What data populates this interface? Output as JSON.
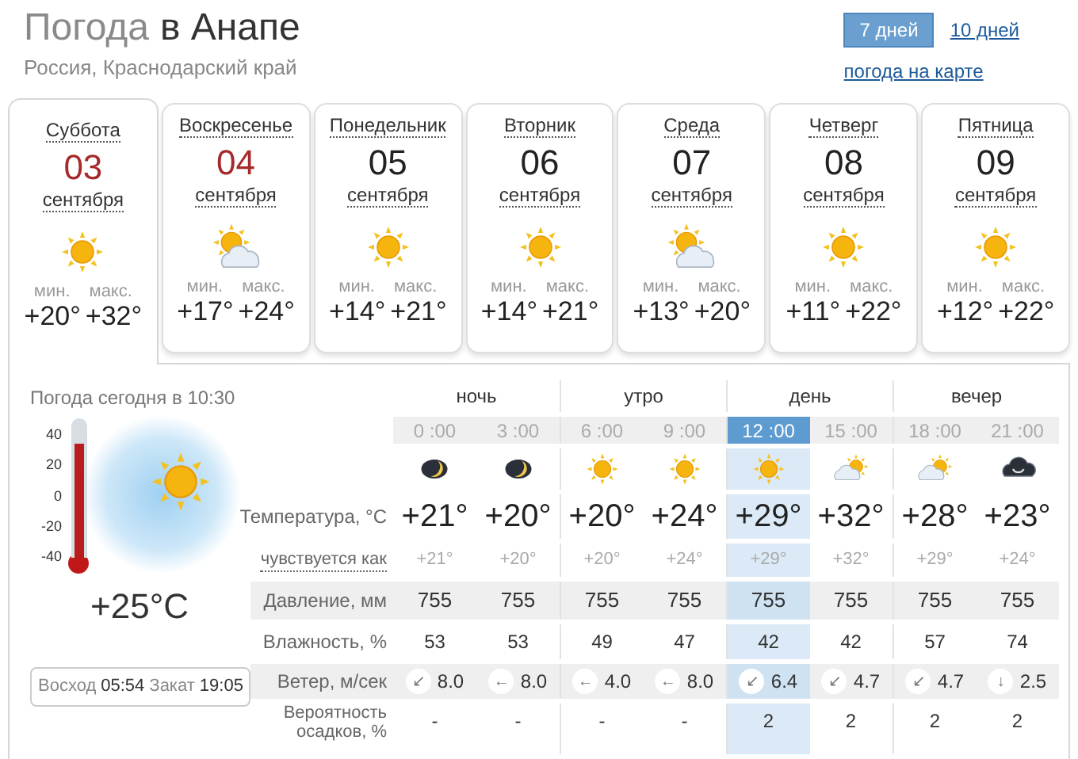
{
  "header": {
    "title_prefix": "Погода",
    "city": "в Анапе",
    "region": "Россия, Краснодарский край",
    "tabs": [
      {
        "label": "7 дней",
        "selected": true
      },
      {
        "label": "10 дней",
        "selected": false
      }
    ],
    "map_link": "погода на карте"
  },
  "days": [
    {
      "weekday": "Суббота",
      "date": "03",
      "month": "сентября",
      "kind": "sun",
      "weekend": true,
      "selected": true,
      "min_label": "мин.",
      "max_label": "макс.",
      "min": "+20°",
      "max": "+32°"
    },
    {
      "weekday": "Воскресенье",
      "date": "04",
      "month": "сентября",
      "kind": "partly_cloudy",
      "weekend": true,
      "selected": false,
      "min_label": "мин.",
      "max_label": "макс.",
      "min": "+17°",
      "max": "+24°"
    },
    {
      "weekday": "Понедельник",
      "date": "05",
      "month": "сентября",
      "kind": "sun",
      "weekend": false,
      "selected": false,
      "min_label": "мин.",
      "max_label": "макс.",
      "min": "+14°",
      "max": "+21°"
    },
    {
      "weekday": "Вторник",
      "date": "06",
      "month": "сентября",
      "kind": "sun",
      "weekend": false,
      "selected": false,
      "min_label": "мин.",
      "max_label": "макс.",
      "min": "+14°",
      "max": "+21°"
    },
    {
      "weekday": "Среда",
      "date": "07",
      "month": "сентября",
      "kind": "partly_cloudy",
      "weekend": false,
      "selected": false,
      "min_label": "мин.",
      "max_label": "макс.",
      "min": "+13°",
      "max": "+20°"
    },
    {
      "weekday": "Четверг",
      "date": "08",
      "month": "сентября",
      "kind": "sun",
      "weekend": false,
      "selected": false,
      "min_label": "мин.",
      "max_label": "макс.",
      "min": "+11°",
      "max": "+22°"
    },
    {
      "weekday": "Пятница",
      "date": "09",
      "month": "сентября",
      "kind": "sun",
      "weekend": false,
      "selected": false,
      "min_label": "мин.",
      "max_label": "макс.",
      "min": "+12°",
      "max": "+22°"
    }
  ],
  "current": {
    "caption": "Погода сегодня в 10:30",
    "scale": [
      "40",
      "20",
      "0",
      "-20",
      "-40"
    ],
    "level": 0.82,
    "temperature": "+25°C",
    "sunrise_label": "Восход",
    "sunrise": "05:54",
    "sunset_label": "Закат",
    "sunset": "19:05"
  },
  "table": {
    "periods": [
      "ночь",
      "утро",
      "день",
      "вечер"
    ],
    "row_labels": {
      "temperature": "Температура, °C",
      "feels": "чувствуется как",
      "pressure": "Давление, мм",
      "humidity": "Влажность, %",
      "wind": "Ветер, м/сек",
      "precipitation": "Вероятность осадков, %"
    },
    "hours": [
      {
        "time": "0 :00",
        "kind": "moon",
        "temp": "+21°",
        "feels": "+21°",
        "pressure": "755",
        "humidity": "53",
        "wind_dir": "↙",
        "wind": "8.0",
        "precipitation": "-",
        "selected": false
      },
      {
        "time": "3 :00",
        "kind": "moon",
        "temp": "+20°",
        "feels": "+20°",
        "pressure": "755",
        "humidity": "53",
        "wind_dir": "←",
        "wind": "8.0",
        "precipitation": "-",
        "selected": false
      },
      {
        "time": "6 :00",
        "kind": "sun",
        "temp": "+20°",
        "feels": "+20°",
        "pressure": "755",
        "humidity": "49",
        "wind_dir": "←",
        "wind": "4.0",
        "precipitation": "-",
        "selected": false
      },
      {
        "time": "9 :00",
        "kind": "sun",
        "temp": "+24°",
        "feels": "+24°",
        "pressure": "755",
        "humidity": "47",
        "wind_dir": "←",
        "wind": "8.0",
        "precipitation": "-",
        "selected": false
      },
      {
        "time": "12 :00",
        "kind": "sun",
        "temp": "+29°",
        "feels": "+29°",
        "pressure": "755",
        "humidity": "42",
        "wind_dir": "↙",
        "wind": "6.4",
        "precipitation": "2",
        "selected": true
      },
      {
        "time": "15 :00",
        "kind": "sun_cloud",
        "temp": "+32°",
        "feels": "+32°",
        "pressure": "755",
        "humidity": "42",
        "wind_dir": "↙",
        "wind": "4.7",
        "precipitation": "2",
        "selected": false
      },
      {
        "time": "18 :00",
        "kind": "sun_cloud",
        "temp": "+28°",
        "feels": "+29°",
        "pressure": "755",
        "humidity": "57",
        "wind_dir": "↙",
        "wind": "4.7",
        "precipitation": "2",
        "selected": false
      },
      {
        "time": "21 :00",
        "kind": "night_cloud",
        "temp": "+23°",
        "feels": "+24°",
        "pressure": "755",
        "humidity": "74",
        "wind_dir": "↓",
        "wind": "2.5",
        "precipitation": "2",
        "selected": false
      }
    ]
  }
}
